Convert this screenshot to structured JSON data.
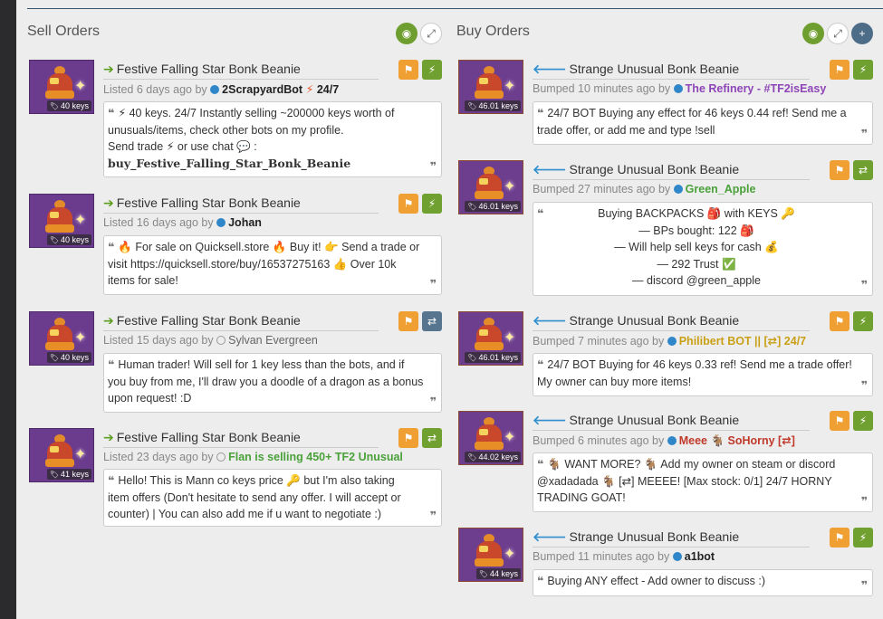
{
  "sell": {
    "title": "Sell Orders",
    "listings": [
      {
        "item_name": "Festive Falling Star Bonk Beanie",
        "price": "40 keys",
        "meta_prefix": "Listed 6 days ago by",
        "user": "2ScrapyardBot",
        "user_suffix": "24/7",
        "comment_lines": [
          "⚡ 40 keys. 24/7 Instantly selling ~200000 keys worth of",
          "unusuals/items, check other bots on my profile.",
          "Send  trade ⚡ or  use  chat 💬 :",
          "buy_Festive_Falling_Star_Bonk_Beanie"
        ]
      },
      {
        "item_name": "Festive Falling Star Bonk Beanie",
        "price": "40 keys",
        "meta_prefix": "Listed 16 days ago by",
        "user": "Johan",
        "comment_lines": [
          "🔥 For sale on Quicksell.store 🔥  Buy it!  👉  Send a trade or",
          "visit https://quicksell.store/buy/16537275163  👍  Over 10k",
          "items for sale!"
        ]
      },
      {
        "item_name": "Festive Falling Star Bonk Beanie",
        "price": "40 keys",
        "meta_prefix": "Listed 15 days ago by",
        "user": "Sylvan Evergreen",
        "comment_lines": [
          "Human trader! Will sell for 1 key less than the bots, and if",
          "you buy from me, I'll draw you a doodle of a dragon as a bonus",
          "upon request! :D"
        ]
      },
      {
        "item_name": "Festive Falling Star Bonk Beanie",
        "price": "41 keys",
        "meta_prefix": "Listed 23 days ago by",
        "user": "Flan is selling 450+ TF2 Unusual",
        "comment_lines": [
          "Hello! This is Mann co keys price 🔑  but I'm also taking",
          "item offers (Don't hesitate to send any offer. I will accept or",
          "counter) | You can also add me if u want to negotiate :)"
        ]
      }
    ]
  },
  "buy": {
    "title": "Buy Orders",
    "listings": [
      {
        "item_name": "Strange Unusual Bonk Beanie",
        "price": "46.01 keys",
        "meta_prefix": "Bumped 10 minutes ago by",
        "user": "The Refinery - #TF2isEasy",
        "comment_lines": [
          "24/7 BOT Buying any effect for 46 keys 0.44 ref! Send me a",
          "trade offer, or add me and type !sell"
        ]
      },
      {
        "item_name": "Strange Unusual Bonk Beanie",
        "price": "46.01 keys",
        "meta_prefix": "Bumped 27 minutes ago by",
        "user": "Green_Apple",
        "comment_lines": [
          "Buying BACKPACKS 🎒 with KEYS 🔑",
          "— BPs bought: 122 🎒",
          "— Will help sell keys for cash 💰",
          "— 292 Trust ✅",
          "— discord @green_apple"
        ]
      },
      {
        "item_name": "Strange Unusual Bonk Beanie",
        "price": "46.01 keys",
        "meta_prefix": "Bumped 7 minutes ago by",
        "user": "Philibert BOT || [⇄] 24/7",
        "comment_lines": [
          "24/7 BOT Buying for 46 keys 0.33 ref! Send me a trade offer!",
          "My owner can buy more items!"
        ]
      },
      {
        "item_name": "Strange Unusual Bonk Beanie",
        "price": "44.02 keys",
        "meta_prefix": "Bumped 6 minutes ago by",
        "user": "Meee 🐐 SoHorny [⇄]",
        "comment_lines": [
          "🐐  WANT MORE?  🐐  Add my owner on steam or discord",
          "@xadadada  🐐  [⇄] MEEEE! [Max stock: 0/1] 24/7 HORNY",
          "TRADING GOAT!"
        ]
      },
      {
        "item_name": "Strange Unusual Bonk Beanie",
        "price": "44 keys",
        "meta_prefix": "Bumped 11 minutes ago by",
        "user": "a1bot",
        "comment_lines": [
          "Buying ANY effect - Add owner to discuss :)"
        ]
      }
    ]
  }
}
